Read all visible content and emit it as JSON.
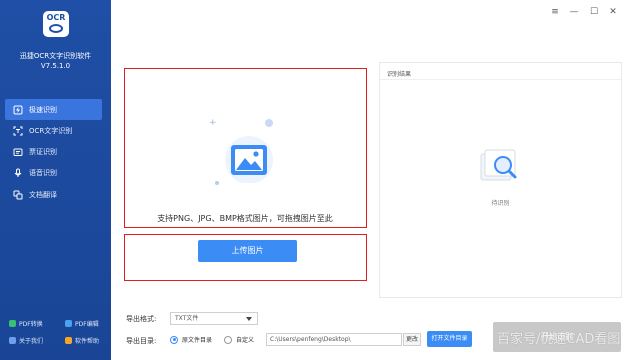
{
  "app": {
    "logo_text": "OCR",
    "name": "迅捷OCR文字识别软件",
    "version": "V7.5.1.0"
  },
  "sidebar": {
    "items": [
      {
        "label": "极速识别",
        "icon": "lightning-icon",
        "active": true
      },
      {
        "label": "OCR文字识别",
        "icon": "text-scan-icon",
        "active": false
      },
      {
        "label": "票证识别",
        "icon": "ticket-icon",
        "active": false
      },
      {
        "label": "语音识别",
        "icon": "microphone-icon",
        "active": false
      },
      {
        "label": "文档翻译",
        "icon": "translate-icon",
        "active": false
      }
    ],
    "bottom_links": {
      "pdf_convert": "PDF转换",
      "pdf_edit": "PDF编辑",
      "about": "关于我们",
      "help": "软件帮助"
    }
  },
  "window_controls": {
    "menu": "≡",
    "minimize": "—",
    "maximize": "☐",
    "close": "✕"
  },
  "main": {
    "drop_hint": "支持PNG、JPG、BMP格式图片，可拖拽图片至此",
    "upload_label": "上传图片"
  },
  "result": {
    "title": "识别结果",
    "empty_text": "待识别"
  },
  "settings": {
    "export_format_label": "导出格式:",
    "export_format_value": "TXT文件",
    "export_dir_label": "导出目录:",
    "dir_option_original": "原文件目录",
    "dir_option_custom": "自定义",
    "dir_path": "C:\\Users\\penfeng\\Desktop\\",
    "change_label": "更改",
    "open_dir_label": "打开文件目录",
    "start_label": "开始识别"
  },
  "watermark": "百家号/优速CAD看图",
  "colors": {
    "sidebar": "#1f4fa6",
    "active_nav": "#3a74dd",
    "accent": "#3b8cf5",
    "highlight_border": "#e02020"
  }
}
